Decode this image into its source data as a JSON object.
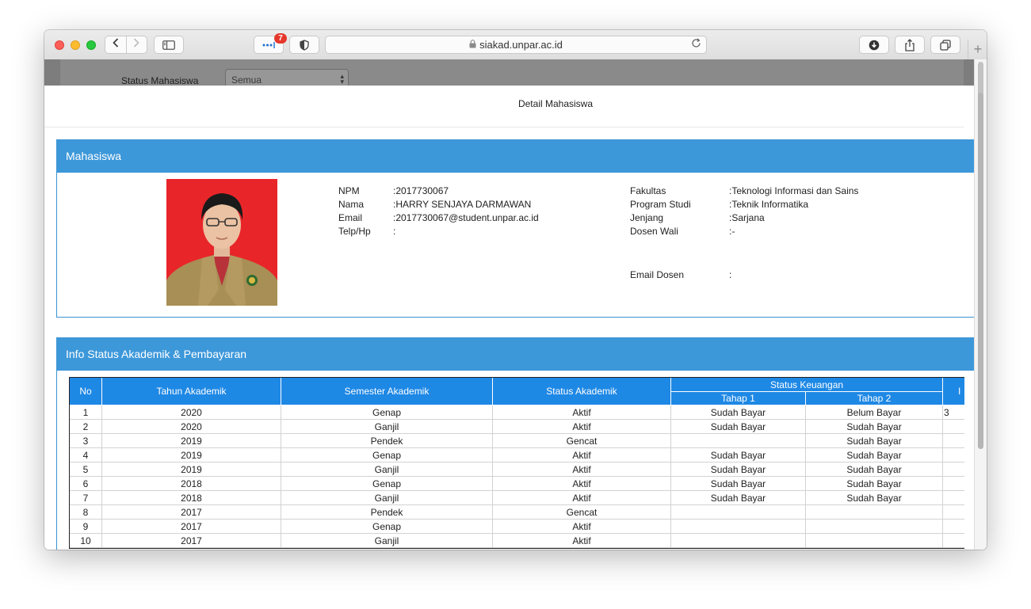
{
  "browser": {
    "url": "siakad.unpar.ac.id",
    "extension_badge": "7"
  },
  "background_page": {
    "filter_label": "Status Mahasiswa",
    "filter_value": "Semua"
  },
  "modal": {
    "title": "Detail Mahasiswa"
  },
  "student_panel": {
    "title": "Mahasiswa",
    "left_fields": [
      {
        "label": "NPM",
        "value": "2017730067"
      },
      {
        "label": "Nama",
        "value": "HARRY SENJAYA DARMAWAN"
      },
      {
        "label": "Email",
        "value": "2017730067@student.unpar.ac.id"
      },
      {
        "label": "Telp/Hp",
        "value": ""
      }
    ],
    "right_fields": [
      {
        "label": "Fakultas",
        "value": "Teknologi Informasi dan Sains"
      },
      {
        "label": "Program Studi",
        "value": "Teknik Informatika"
      },
      {
        "label": "Jenjang",
        "value": "Sarjana"
      },
      {
        "label": "Dosen Wali",
        "value": "-"
      },
      {
        "label": "Email Dosen",
        "value": ""
      }
    ],
    "separator": ":"
  },
  "status_panel": {
    "title": "Info Status Akademik & Pembayaran",
    "headers": {
      "no": "No",
      "tahun": "Tahun Akademik",
      "semester": "Semester Akademik",
      "status": "Status Akademik",
      "keuangan": "Status Keuangan",
      "tahap1": "Tahap 1",
      "tahap2": "Tahap 2",
      "truncated": "I"
    },
    "rows": [
      {
        "no": "1",
        "tahun": "2020",
        "semester": "Genap",
        "status": "Aktif",
        "tahap1": "Sudah Bayar",
        "tahap2": "Belum Bayar",
        "extra": "3"
      },
      {
        "no": "2",
        "tahun": "2020",
        "semester": "Ganjil",
        "status": "Aktif",
        "tahap1": "Sudah Bayar",
        "tahap2": "Sudah Bayar",
        "extra": ""
      },
      {
        "no": "3",
        "tahun": "2019",
        "semester": "Pendek",
        "status": "Gencat",
        "tahap1": "",
        "tahap2": "Sudah Bayar",
        "extra": ""
      },
      {
        "no": "4",
        "tahun": "2019",
        "semester": "Genap",
        "status": "Aktif",
        "tahap1": "Sudah Bayar",
        "tahap2": "Sudah Bayar",
        "extra": ""
      },
      {
        "no": "5",
        "tahun": "2019",
        "semester": "Ganjil",
        "status": "Aktif",
        "tahap1": "Sudah Bayar",
        "tahap2": "Sudah Bayar",
        "extra": ""
      },
      {
        "no": "6",
        "tahun": "2018",
        "semester": "Genap",
        "status": "Aktif",
        "tahap1": "Sudah Bayar",
        "tahap2": "Sudah Bayar",
        "extra": ""
      },
      {
        "no": "7",
        "tahun": "2018",
        "semester": "Ganjil",
        "status": "Aktif",
        "tahap1": "Sudah Bayar",
        "tahap2": "Sudah Bayar",
        "extra": ""
      },
      {
        "no": "8",
        "tahun": "2017",
        "semester": "Pendek",
        "status": "Gencat",
        "tahap1": "",
        "tahap2": "",
        "extra": ""
      },
      {
        "no": "9",
        "tahun": "2017",
        "semester": "Genap",
        "status": "Aktif",
        "tahap1": "",
        "tahap2": "",
        "extra": ""
      },
      {
        "no": "10",
        "tahun": "2017",
        "semester": "Ganjil",
        "status": "Aktif",
        "tahap1": "",
        "tahap2": "",
        "extra": ""
      }
    ]
  },
  "colors": {
    "panel_header": "#3d98da",
    "table_header": "#1e88e5"
  }
}
